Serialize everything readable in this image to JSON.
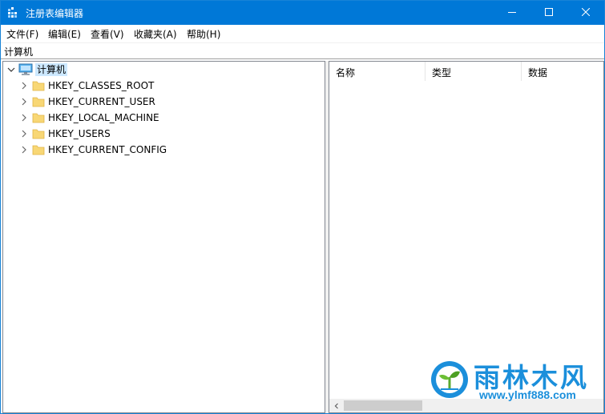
{
  "window": {
    "title": "注册表编辑器",
    "accent_color": "#0078d7",
    "controls": {
      "minimize_icon": "minimize-icon",
      "maximize_icon": "maximize-icon",
      "close_icon": "close-icon"
    }
  },
  "menubar": {
    "items": [
      {
        "label": "文件(F)"
      },
      {
        "label": "编辑(E)"
      },
      {
        "label": "查看(V)"
      },
      {
        "label": "收藏夹(A)"
      },
      {
        "label": "帮助(H)"
      }
    ]
  },
  "address": {
    "path": "计算机"
  },
  "tree": {
    "root": {
      "label": "计算机",
      "icon": "computer-icon",
      "expanded": true,
      "selected": true
    },
    "children": [
      {
        "label": "HKEY_CLASSES_ROOT",
        "icon": "folder-icon"
      },
      {
        "label": "HKEY_CURRENT_USER",
        "icon": "folder-icon"
      },
      {
        "label": "HKEY_LOCAL_MACHINE",
        "icon": "folder-icon"
      },
      {
        "label": "HKEY_USERS",
        "icon": "folder-icon"
      },
      {
        "label": "HKEY_CURRENT_CONFIG",
        "icon": "folder-icon"
      }
    ]
  },
  "list": {
    "columns": [
      {
        "label": "名称"
      },
      {
        "label": "类型"
      },
      {
        "label": "数据"
      }
    ],
    "rows": []
  },
  "watermark": {
    "title": "雨林木风",
    "url": "www.ylmf888.com",
    "color": "#1b8fdb"
  }
}
